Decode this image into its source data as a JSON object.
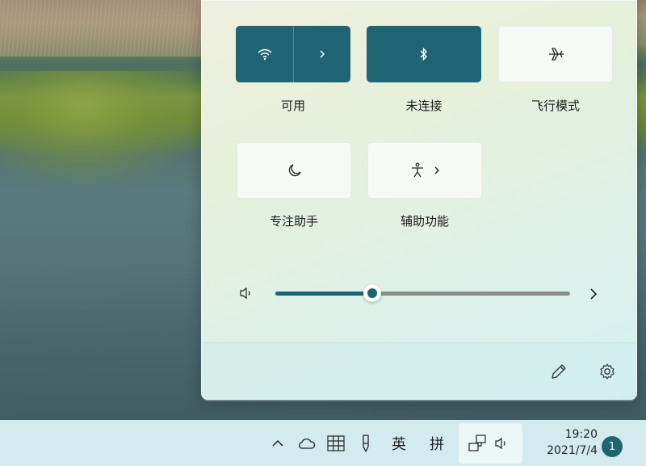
{
  "quick_settings": {
    "tiles": [
      {
        "label": "可用",
        "icon": "wifi-icon",
        "state": "on",
        "has_expand": true
      },
      {
        "label": "未连接",
        "icon": "bluetooth-icon",
        "state": "on",
        "has_expand": false
      },
      {
        "label": "飞行模式",
        "icon": "airplane-icon",
        "state": "off",
        "has_expand": false
      },
      {
        "label": "专注助手",
        "icon": "moon-icon",
        "state": "off",
        "has_expand": false
      },
      {
        "label": "辅助功能",
        "icon": "accessibility-icon",
        "state": "off",
        "has_expand": true
      }
    ],
    "volume": {
      "icon": "speaker-icon",
      "level_fraction": 0.33
    },
    "footer": {
      "edit_icon": "pencil-icon",
      "settings_icon": "gear-icon"
    }
  },
  "taskbar": {
    "items": [
      {
        "name": "show-hidden-icons",
        "icon": "chevron-up-icon"
      },
      {
        "name": "onedrive",
        "icon": "cloud-icon"
      },
      {
        "name": "touch-keyboard",
        "icon": "grid-icon"
      },
      {
        "name": "pen-menu",
        "icon": "pen-icon"
      }
    ],
    "ime_lang": "英",
    "ime_mode": "拼",
    "network_icon": "network-icon",
    "volume_icon": "speaker-icon",
    "time": "19:20",
    "date": "2021/7/4",
    "notification_count": "1"
  },
  "colors": {
    "accent": "#1f6473",
    "taskbar": "#d3ebee"
  }
}
